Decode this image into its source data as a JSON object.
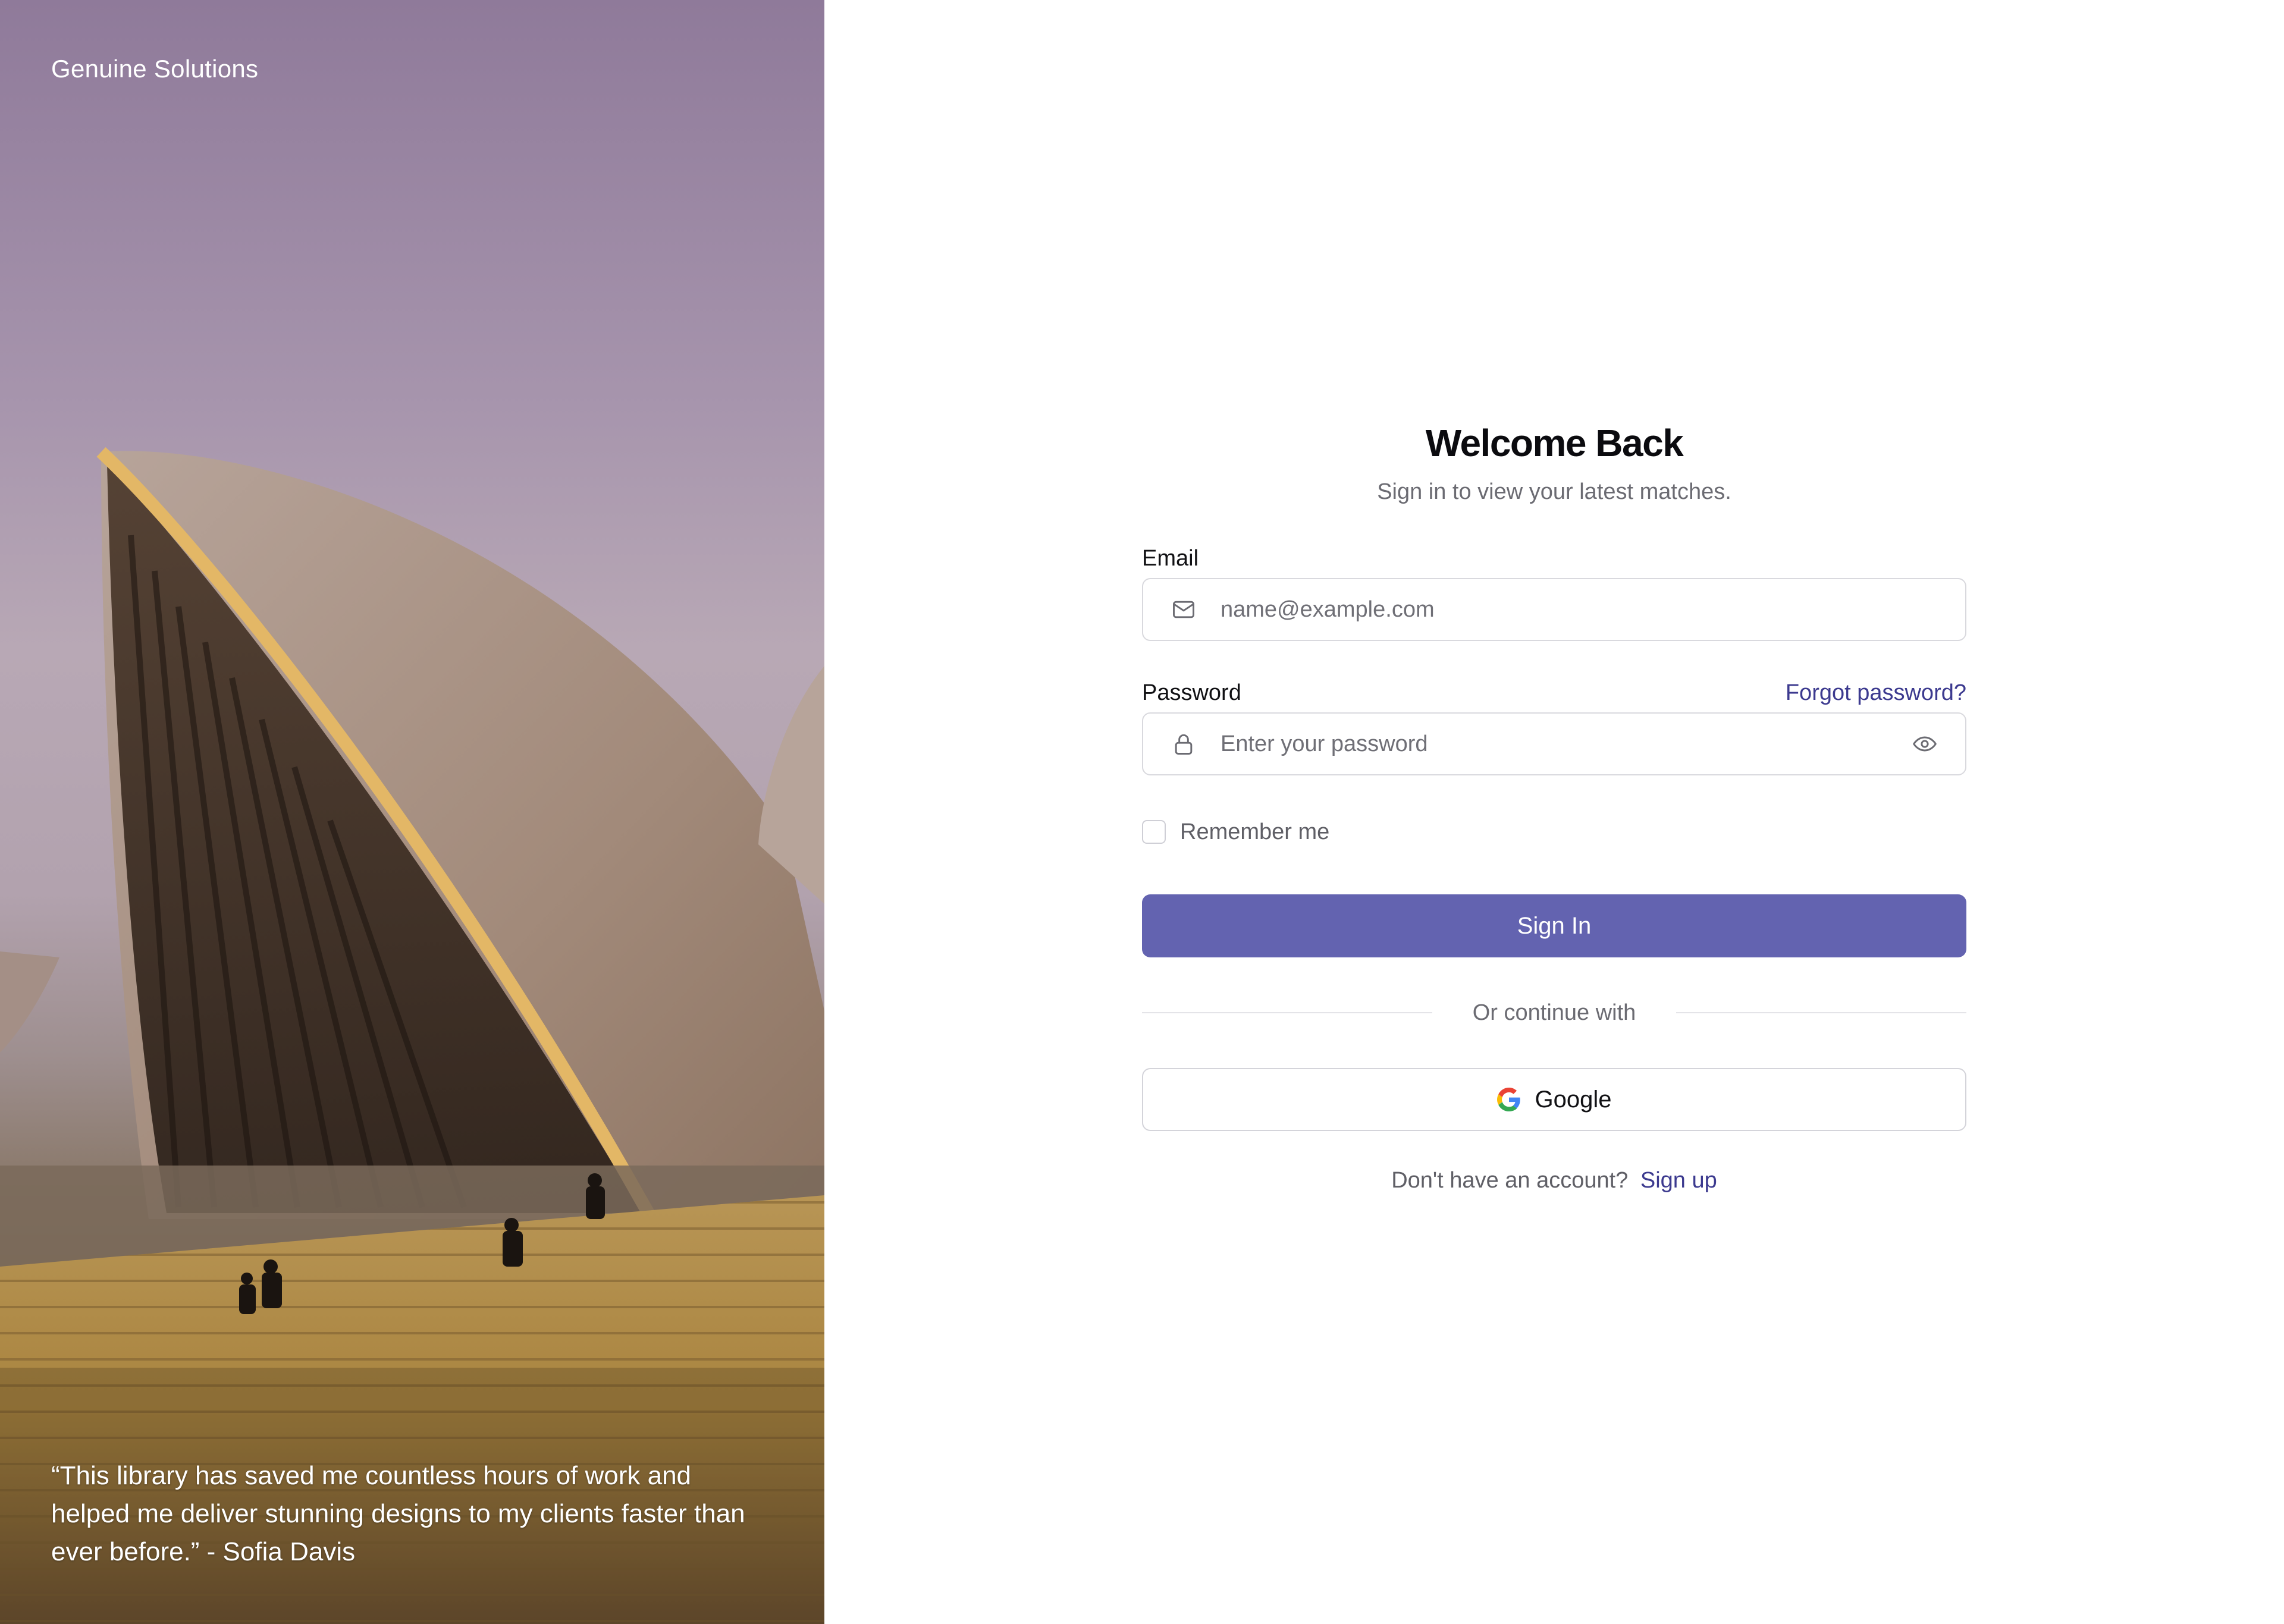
{
  "hero": {
    "brand": "Genuine Solutions",
    "quote": "“This library has saved me countless hours of work and helped me deliver stunning designs to my clients faster than ever before.” - Sofia Davis"
  },
  "form": {
    "title": "Welcome Back",
    "subtitle": "Sign in to view your latest matches.",
    "email": {
      "label": "Email",
      "placeholder": "name@example.com",
      "value": "",
      "icon": "mail-icon"
    },
    "password": {
      "label": "Password",
      "placeholder": "Enter your password",
      "value": "",
      "icon": "lock-icon",
      "toggle_icon": "eye-icon",
      "forgot_label": "Forgot password?"
    },
    "remember": {
      "label": "Remember me",
      "checked": false
    },
    "submit_label": "Sign In",
    "divider_text": "Or continue with",
    "oauth": {
      "provider_label": "Google",
      "icon": "google-icon"
    },
    "signup": {
      "prompt": "Don't have an account?",
      "link_label": "Sign up"
    }
  },
  "colors": {
    "primary": "#6363b0",
    "link": "#3c3a8f",
    "border": "#d9d9de",
    "muted_text": "#6b6b72"
  }
}
